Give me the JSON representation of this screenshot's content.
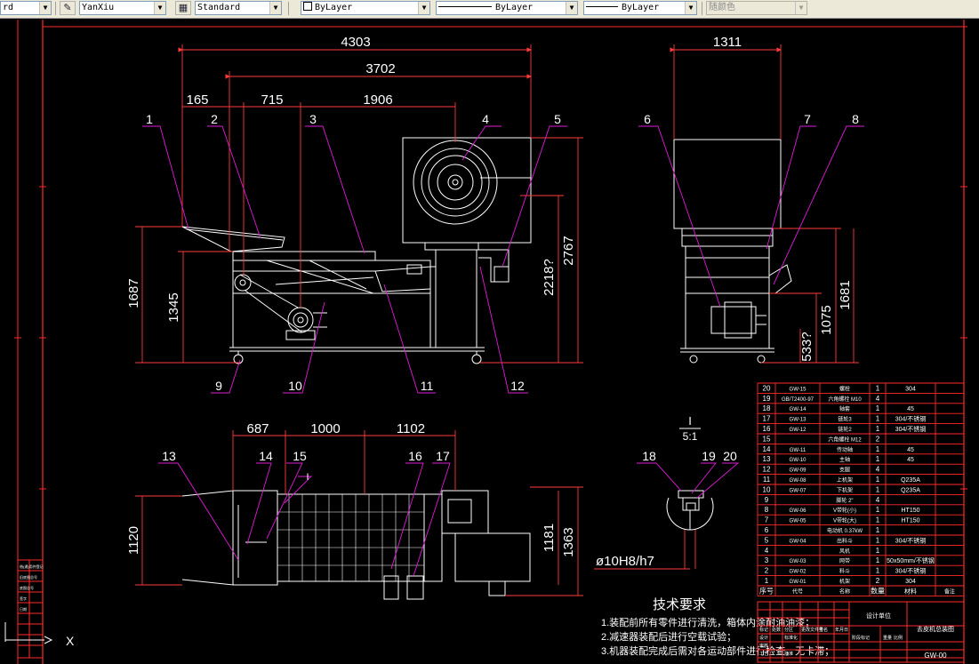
{
  "toolbar": {
    "text_style": "rd",
    "dim_style": "YanXiu",
    "table_style": "Standard",
    "layer_color": "ByLayer",
    "linetype": "ByLayer",
    "lineweight": "ByLayer",
    "plot_style": "随颜色",
    "dim_style_icon": "dimension-style-icon",
    "table_style_icon": "table-style-icon"
  },
  "dims": {
    "d4303": "4303",
    "d3702": "3702",
    "d165": "165",
    "d715": "715",
    "d1906": "1906",
    "d1311": "1311",
    "d1687": "1687",
    "d1345": "1345",
    "d2218": "2218?",
    "d2767": "2767",
    "d1075": "1075",
    "d1681": "1681",
    "d533": "533?",
    "d687": "687",
    "d1000": "1000",
    "d1102": "1102",
    "d1120": "1120",
    "d1181": "1181",
    "d1363": "1363",
    "fit": "ø10H8/h7"
  },
  "detail": {
    "label": "I",
    "scale": "5:1"
  },
  "balloons": [
    "1",
    "2",
    "3",
    "4",
    "5",
    "6",
    "7",
    "8",
    "9",
    "10",
    "11",
    "12",
    "13",
    "14",
    "15",
    "16",
    "17",
    "18",
    "19",
    "20"
  ],
  "section_mark": "I",
  "notes": {
    "title": "技术要求",
    "items": [
      "1.装配前所有零件进行清洗，箱体内涂耐油油漆；",
      "2.减速器装配后进行空载试验；",
      "3.机器装配完成后需对各运动部件进行检查，无卡滞；"
    ]
  },
  "bom": {
    "rows": [
      [
        "20",
        "GW-15",
        "螺栓",
        "1",
        "304",
        ""
      ],
      [
        "19",
        "GB/T2400-97",
        "六角螺栓 M10",
        "4",
        "",
        ""
      ],
      [
        "18",
        "GW-14",
        "轴套",
        "1",
        "45",
        ""
      ],
      [
        "17",
        "GW-13",
        "链轮3",
        "1",
        "304/不锈钢",
        ""
      ],
      [
        "16",
        "GW-12",
        "链轮2",
        "1",
        "304/不锈钢",
        ""
      ],
      [
        "15",
        "",
        "六角螺栓 M12",
        "2",
        "",
        ""
      ],
      [
        "14",
        "GW-11",
        "传动轴",
        "1",
        "45",
        ""
      ],
      [
        "13",
        "GW-10",
        "主轴",
        "1",
        "45",
        ""
      ],
      [
        "12",
        "GW-09",
        "支腿",
        "4",
        "",
        ""
      ],
      [
        "11",
        "GW-08",
        "上机架",
        "1",
        "Q235A",
        ""
      ],
      [
        "10",
        "GW-07",
        "下机架",
        "1",
        "Q235A",
        ""
      ],
      [
        "9",
        "",
        "脚轮 2\"",
        "4",
        "",
        ""
      ],
      [
        "8",
        "GW-06",
        "V带轮(小)",
        "1",
        "HT150",
        ""
      ],
      [
        "7",
        "GW-05",
        "V带轮(大)",
        "1",
        "HT150",
        ""
      ],
      [
        "6",
        "",
        "电动机 0.37kW",
        "1",
        "",
        ""
      ],
      [
        "5",
        "GW-04",
        "出料斗",
        "1",
        "304/不锈钢",
        ""
      ],
      [
        "4",
        "",
        "风机",
        "1",
        "",
        ""
      ],
      [
        "3",
        "GW-03",
        "网带",
        "1",
        "50x50mm/不锈钢",
        ""
      ],
      [
        "2",
        "GW-02",
        "料斗",
        "1",
        "304/不锈钢",
        ""
      ],
      [
        "1",
        "GW-01",
        "机架",
        "2",
        "304",
        ""
      ]
    ],
    "header": [
      "序号",
      "代号",
      "名称",
      "数量",
      "材料",
      "备注"
    ]
  },
  "title_block": {
    "company": "设计单位",
    "product": "去皮机总装图",
    "drawing_no": "GW-00",
    "labels": [
      "标记",
      "处数",
      "分区",
      "更改文件号",
      "签名",
      "年月日",
      "设计",
      "标准化",
      "审核",
      "工艺",
      "批准",
      "阶段标记",
      "重量",
      "比例"
    ]
  },
  "left_strip": {
    "labels": [
      "借(通)用件登记",
      "旧底图总号",
      "底图总号",
      "签字",
      "日期"
    ]
  },
  "ucs": {
    "axis": "X"
  },
  "colors": {
    "geometry": "#ffffff",
    "dimension": "#ff3b3b",
    "border": "#ff2a2a",
    "leader": "#e01bd6",
    "bg": "#000000"
  }
}
